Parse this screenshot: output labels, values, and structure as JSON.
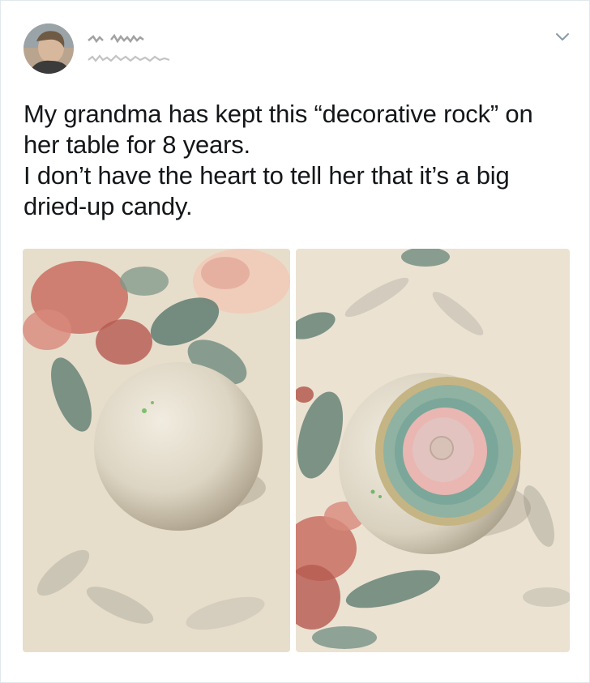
{
  "tweet": {
    "text": "My grandma has kept this “decorative rock” on her table for 8 years.\nI don’t have the heart to tell her that it’s a big dried-up candy."
  },
  "icons": {
    "menu": "chevron-down-icon"
  },
  "colors": {
    "text": "#14171a",
    "chevron": "#8899a6",
    "border": "#e1e8ed"
  }
}
